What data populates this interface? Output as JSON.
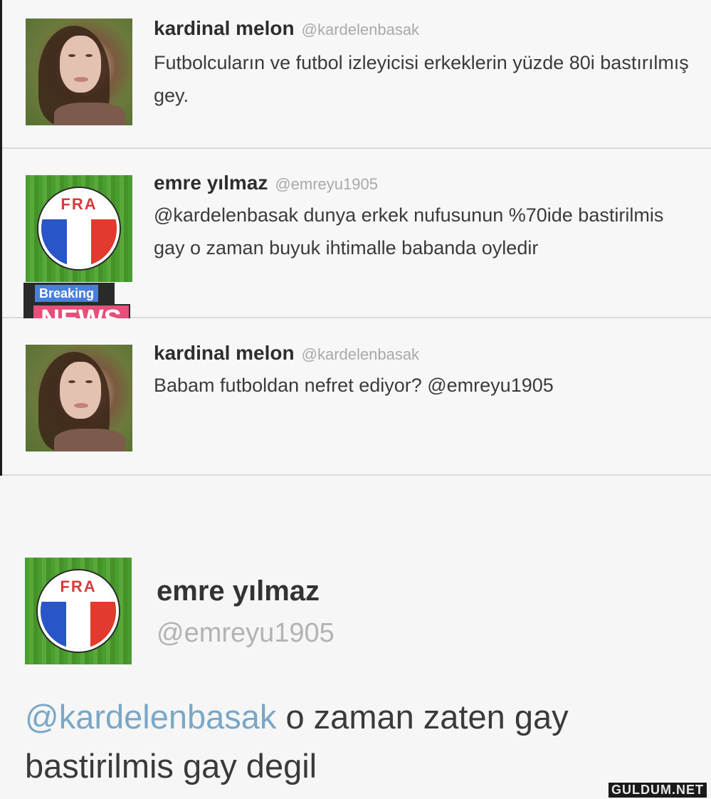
{
  "tweets": [
    {
      "name": "kardinal melon",
      "handle": "@kardelenbasak",
      "text": "Futbolcuların ve futbol izleyicisi erkeklerin yüzde 80i bastırılmış gey.",
      "avatar": "woman-portrait"
    },
    {
      "name": "emre yılmaz",
      "handle": "@emreyu1905",
      "text": "@kardelenbasak dunya erkek nufusunun %70ide bastirilmis gay o zaman buyuk ihtimalle babanda oyledir",
      "avatar": "fra-badge",
      "badge_label": "FRA"
    },
    {
      "name": "kardinal melon",
      "handle": "@kardelenbasak",
      "text": "Babam futboldan nefret ediyor? @emreyu1905",
      "avatar": "woman-portrait"
    }
  ],
  "breaking_news": {
    "line1": "Breaking",
    "line2": "NEWS"
  },
  "final_tweet": {
    "name": "emre yılmaz",
    "handle": "@emreyu1905",
    "mention": "@kardelenbasak",
    "text": "o zaman zaten gay bastirilmis gay degil",
    "badge_label": "FRA"
  },
  "watermark": "GULDUM.NET",
  "colors": {
    "mention": "#7aa7c7",
    "handle": "#a9a9a9",
    "breaking_blue": "#4a7fd8",
    "news_pink": "#e64f7a"
  }
}
